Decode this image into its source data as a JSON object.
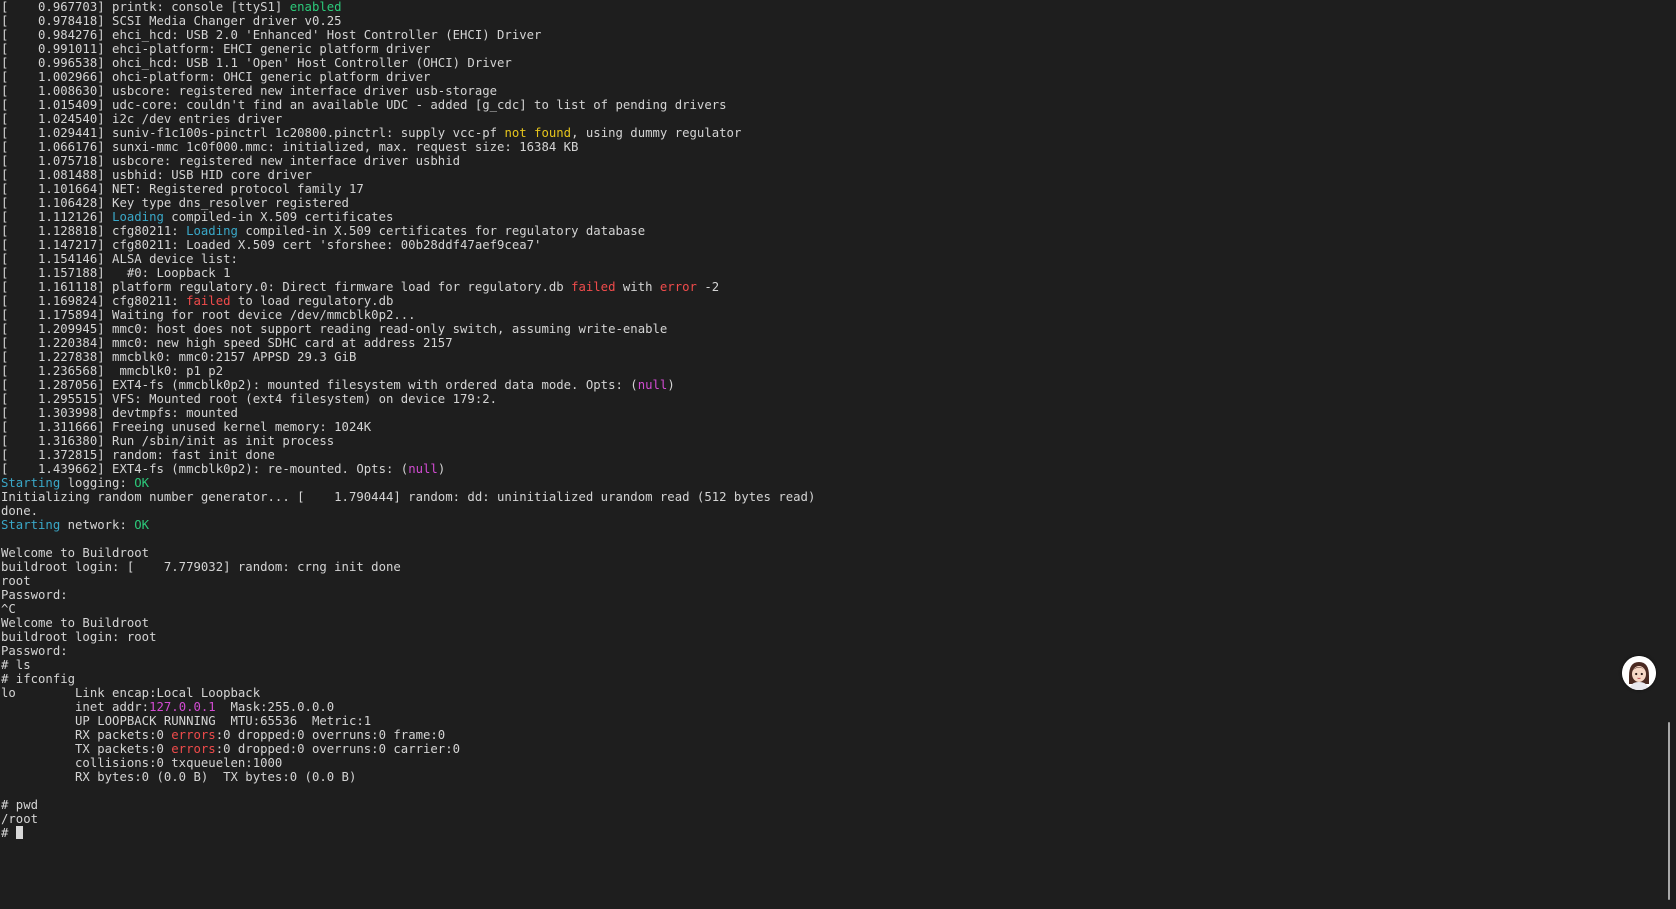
{
  "colors": {
    "background": "#1e1e1e",
    "text": "#d4d4d4",
    "green": "#2cc97a",
    "cyan": "#3aa8c8",
    "yellow": "#e5c41c",
    "red": "#f04b4b",
    "magenta": "#d24bd2"
  },
  "assistant_avatar": {
    "icon": "avatar-icon"
  },
  "terminal_lines": [
    [
      {
        "t": "[    0.967703] printk: console [ttyS1] "
      },
      {
        "t": "enabled",
        "c": "green"
      }
    ],
    [
      {
        "t": "[    0.978418] SCSI Media Changer driver v0.25"
      }
    ],
    [
      {
        "t": "[    0.984276] ehci_hcd: USB 2.0 'Enhanced' Host Controller (EHCI) Driver"
      }
    ],
    [
      {
        "t": "[    0.991011] ehci-platform: EHCI generic platform driver"
      }
    ],
    [
      {
        "t": "[    0.996538] ohci_hcd: USB 1.1 'Open' Host Controller (OHCI) Driver"
      }
    ],
    [
      {
        "t": "[    1.002966] ohci-platform: OHCI generic platform driver"
      }
    ],
    [
      {
        "t": "[    1.008630] usbcore: registered new interface driver usb-storage"
      }
    ],
    [
      {
        "t": "[    1.015409] udc-core: couldn't find an available UDC - added [g_cdc] to list of pending drivers"
      }
    ],
    [
      {
        "t": "[    1.024540] i2c /dev entries driver"
      }
    ],
    [
      {
        "t": "[    1.029441] suniv-f1c100s-pinctrl 1c20800.pinctrl: supply vcc-pf "
      },
      {
        "t": "not found",
        "c": "yellow"
      },
      {
        "t": ", using dummy regulator"
      }
    ],
    [
      {
        "t": "[    1.066176] sunxi-mmc 1c0f000.mmc: initialized, max. request size: 16384 KB"
      }
    ],
    [
      {
        "t": "[    1.075718] usbcore: registered new interface driver usbhid"
      }
    ],
    [
      {
        "t": "[    1.081488] usbhid: USB HID core driver"
      }
    ],
    [
      {
        "t": "[    1.101664] NET: Registered protocol family 17"
      }
    ],
    [
      {
        "t": "[    1.106428] Key type dns_resolver registered"
      }
    ],
    [
      {
        "t": "[    1.112126] "
      },
      {
        "t": "Loading",
        "c": "cyan"
      },
      {
        "t": " compiled-in X.509 certificates"
      }
    ],
    [
      {
        "t": "[    1.128818] cfg80211: "
      },
      {
        "t": "Loading",
        "c": "cyan"
      },
      {
        "t": " compiled-in X.509 certificates for regulatory database"
      }
    ],
    [
      {
        "t": "[    1.147217] cfg80211: Loaded X.509 cert 'sforshee: 00b28ddf47aef9cea7'"
      }
    ],
    [
      {
        "t": "[    1.154146] ALSA device list:"
      }
    ],
    [
      {
        "t": "[    1.157188]   #0: Loopback 1"
      }
    ],
    [
      {
        "t": "[    1.161118] platform regulatory.0: Direct firmware load for regulatory.db "
      },
      {
        "t": "failed",
        "c": "red"
      },
      {
        "t": " with "
      },
      {
        "t": "error",
        "c": "red"
      },
      {
        "t": " -2"
      }
    ],
    [
      {
        "t": "[    1.169824] cfg80211: "
      },
      {
        "t": "failed",
        "c": "red"
      },
      {
        "t": " to load regulatory.db"
      }
    ],
    [
      {
        "t": "[    1.175894] Waiting for root device /dev/mmcblk0p2..."
      }
    ],
    [
      {
        "t": "[    1.209945] mmc0: host does not support reading read-only switch, assuming write-enable"
      }
    ],
    [
      {
        "t": "[    1.220384] mmc0: new high speed SDHC card at address 2157"
      }
    ],
    [
      {
        "t": "[    1.227838] mmcblk0: mmc0:2157 APPSD 29.3 GiB"
      }
    ],
    [
      {
        "t": "[    1.236568]  mmcblk0: p1 p2"
      }
    ],
    [
      {
        "t": "[    1.287056] EXT4-fs (mmcblk0p2): mounted filesystem with ordered data mode. Opts: ("
      },
      {
        "t": "null",
        "c": "magenta"
      },
      {
        "t": ")"
      }
    ],
    [
      {
        "t": "[    1.295515] VFS: Mounted root (ext4 filesystem) on device 179:2."
      }
    ],
    [
      {
        "t": "[    1.303998] devtmpfs: mounted"
      }
    ],
    [
      {
        "t": "[    1.311666] Freeing unused kernel memory: 1024K"
      }
    ],
    [
      {
        "t": "[    1.316380] Run /sbin/init as init process"
      }
    ],
    [
      {
        "t": "[    1.372815] random: fast init done"
      }
    ],
    [
      {
        "t": "[    1.439662] EXT4-fs (mmcblk0p2): re-mounted. Opts: ("
      },
      {
        "t": "null",
        "c": "magenta"
      },
      {
        "t": ")"
      }
    ],
    [
      {
        "t": "Starting",
        "c": "cyan"
      },
      {
        "t": " logging: "
      },
      {
        "t": "OK",
        "c": "green"
      }
    ],
    [
      {
        "t": "Initializing random number generator... [    1.790444] random: dd: uninitialized urandom read (512 bytes read)"
      }
    ],
    [
      {
        "t": "done."
      }
    ],
    [
      {
        "t": "Starting",
        "c": "cyan"
      },
      {
        "t": " network: "
      },
      {
        "t": "OK",
        "c": "green"
      }
    ],
    [],
    [
      {
        "t": "Welcome to Buildroot"
      }
    ],
    [
      {
        "t": "buildroot login: [    7.779032] random: crng init done"
      }
    ],
    [
      {
        "t": "root"
      }
    ],
    [
      {
        "t": "Password:"
      }
    ],
    [
      {
        "t": "^C"
      }
    ],
    [
      {
        "t": "Welcome to Buildroot"
      }
    ],
    [
      {
        "t": "buildroot login: root"
      }
    ],
    [
      {
        "t": "Password:"
      }
    ],
    [
      {
        "t": "# ls"
      }
    ],
    [
      {
        "t": "# ifconfig"
      }
    ],
    [
      {
        "t": "lo        Link encap:Local Loopback"
      }
    ],
    [
      {
        "t": "          inet addr:"
      },
      {
        "t": "127.0.0.1",
        "c": "magenta"
      },
      {
        "t": "  Mask:255.0.0.0"
      }
    ],
    [
      {
        "t": "          UP LOOPBACK RUNNING  MTU:65536  Metric:1"
      }
    ],
    [
      {
        "t": "          RX packets:0 "
      },
      {
        "t": "errors",
        "c": "red"
      },
      {
        "t": ":0 dropped:0 overruns:0 frame:0"
      }
    ],
    [
      {
        "t": "          TX packets:0 "
      },
      {
        "t": "errors",
        "c": "red"
      },
      {
        "t": ":0 dropped:0 overruns:0 carrier:0"
      }
    ],
    [
      {
        "t": "          collisions:0 txqueuelen:1000"
      }
    ],
    [
      {
        "t": "          RX bytes:0 (0.0 B)  TX bytes:0 (0.0 B)"
      }
    ],
    [],
    [
      {
        "t": "# pwd"
      }
    ],
    [
      {
        "t": "/root"
      }
    ],
    [
      {
        "t": "# "
      }
    ]
  ]
}
